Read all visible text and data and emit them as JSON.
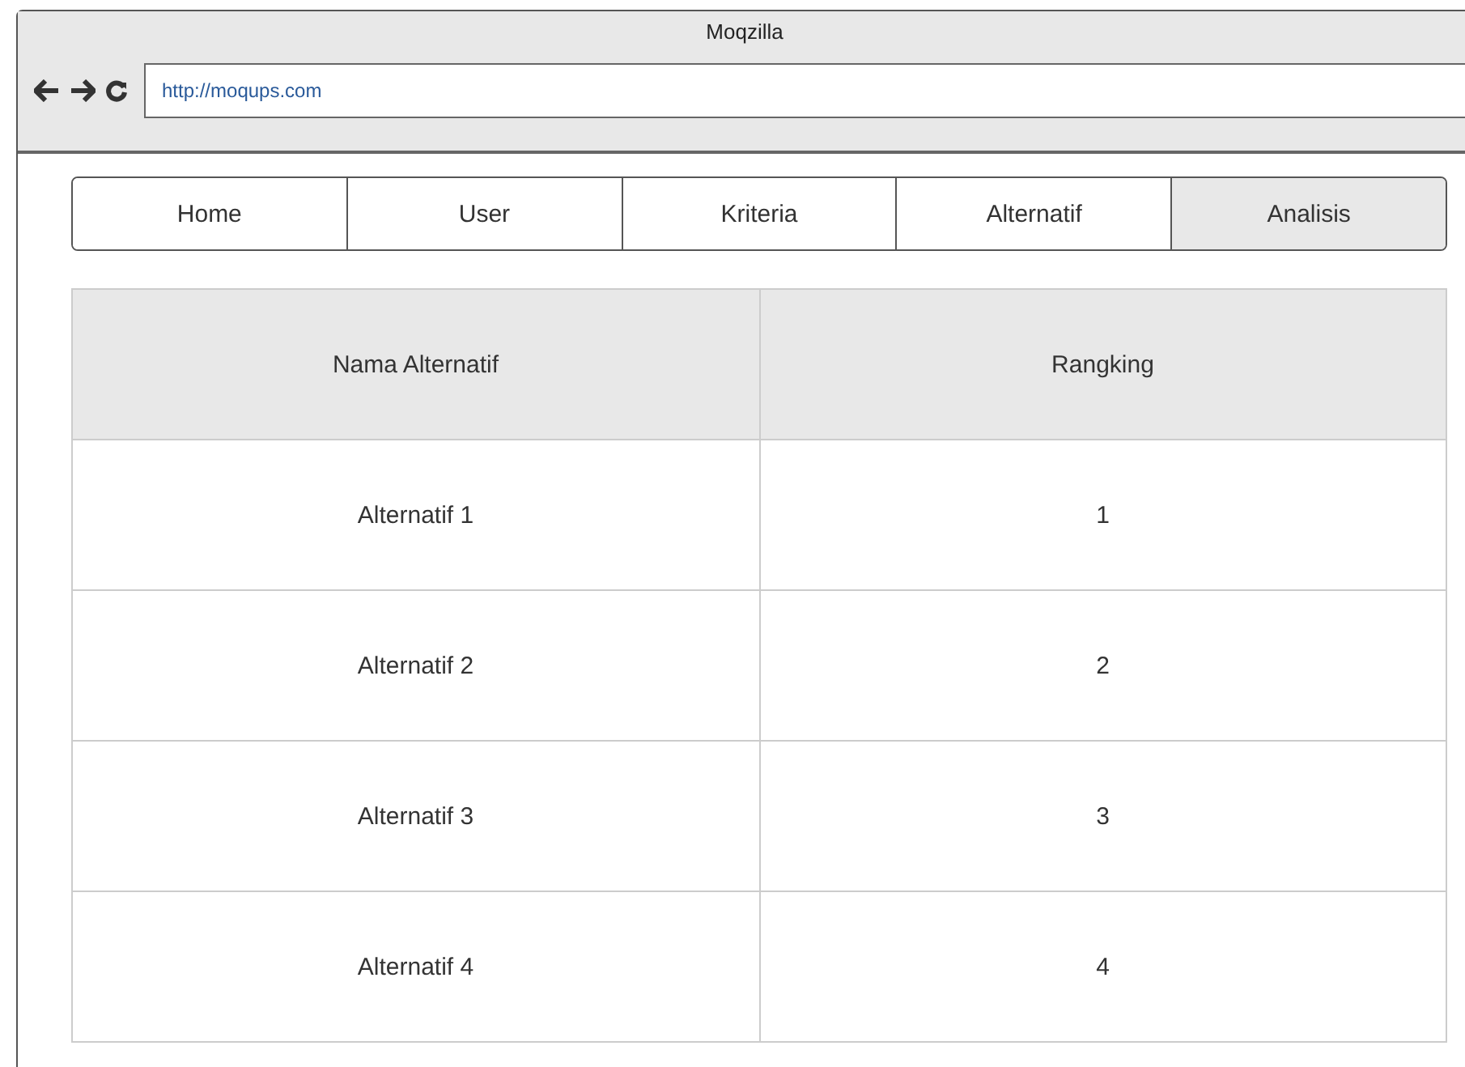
{
  "window": {
    "title": "Moqzilla"
  },
  "address_bar": {
    "value": "http://moqups.com"
  },
  "nav": [
    {
      "label": "Home",
      "selected": false
    },
    {
      "label": "User",
      "selected": false
    },
    {
      "label": "Kriteria",
      "selected": false
    },
    {
      "label": "Alternatif",
      "selected": false
    },
    {
      "label": "Analisis",
      "selected": true
    }
  ],
  "table": {
    "columns": [
      "Nama Alternatif",
      "Rangking"
    ],
    "rows": [
      [
        "Alternatif 1",
        "1"
      ],
      [
        "Alternatif 2",
        "2"
      ],
      [
        "Alternatif 3",
        "3"
      ],
      [
        "Alternatif 4",
        "4"
      ]
    ]
  }
}
